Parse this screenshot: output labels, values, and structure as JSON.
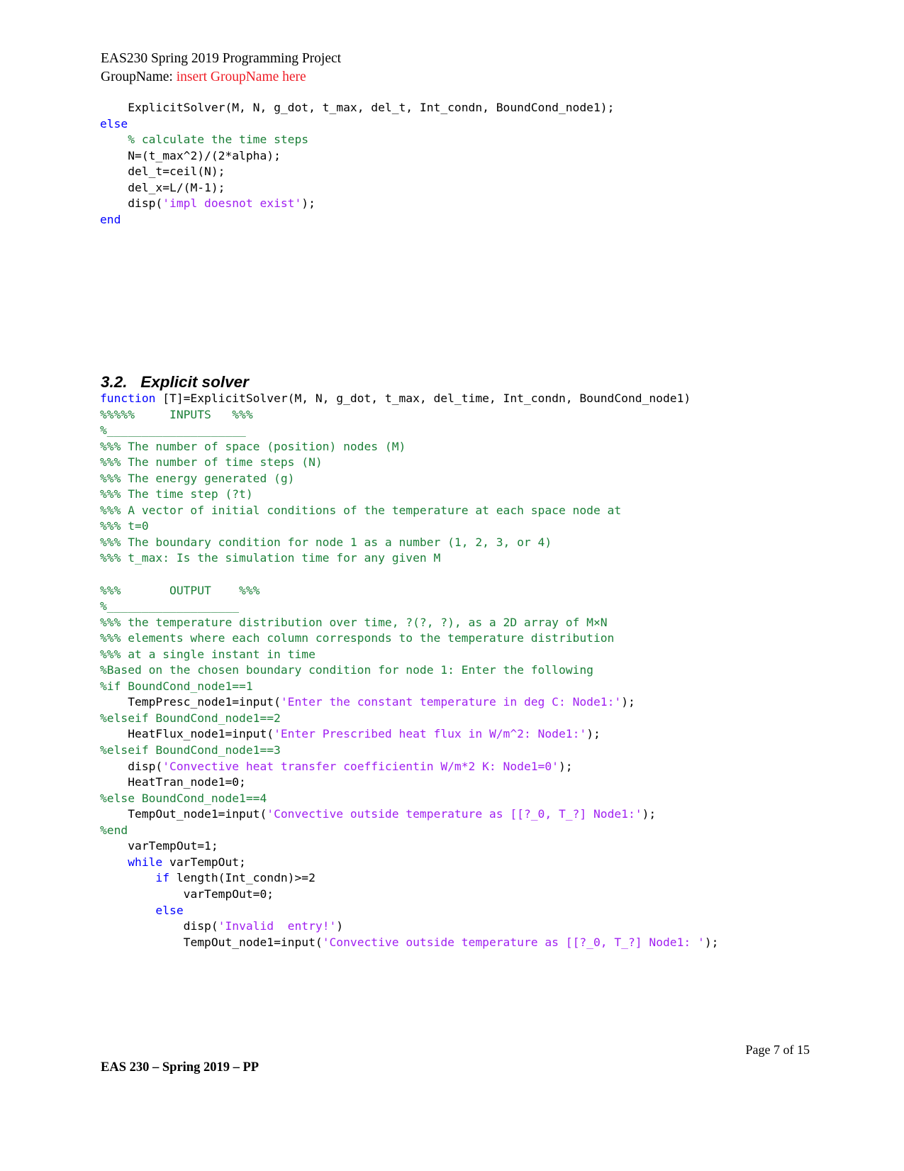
{
  "header": {
    "title_line": "EAS230 Spring 2019 Programming Project",
    "group_label": "GroupName: ",
    "group_value": "insert GroupName here"
  },
  "section": {
    "number": "3.2.",
    "title": "Explicit solver",
    "heading_full": "3.2.   Explicit solver"
  },
  "code_top": {
    "lines": [
      {
        "segments": [
          {
            "t": "    ExplicitSolver(M, N, g_dot, t_max, del_t, Int_condn, BoundCond_node1);",
            "c": "plain"
          }
        ]
      },
      {
        "segments": [
          {
            "t": "else",
            "c": "kw"
          }
        ]
      },
      {
        "segments": [
          {
            "t": "    ",
            "c": "plain"
          },
          {
            "t": "% calculate the time steps",
            "c": "cmt"
          }
        ]
      },
      {
        "segments": [
          {
            "t": "    N=(t_max^2)/(2*alpha);",
            "c": "plain"
          }
        ]
      },
      {
        "segments": [
          {
            "t": "    del_t=ceil(N);",
            "c": "plain"
          }
        ]
      },
      {
        "segments": [
          {
            "t": "    del_x=L/(M-1);",
            "c": "plain"
          }
        ]
      },
      {
        "segments": [
          {
            "t": "    disp(",
            "c": "plain"
          },
          {
            "t": "'impl doesnot exist'",
            "c": "str"
          },
          {
            "t": ");",
            "c": "plain"
          }
        ]
      },
      {
        "segments": [
          {
            "t": "end",
            "c": "kw"
          }
        ]
      }
    ]
  },
  "code_main": {
    "lines": [
      {
        "segments": [
          {
            "t": "function",
            "c": "kw"
          },
          {
            "t": " [T]=ExplicitSolver(M, N, g_dot, t_max, del_time, Int_condn, BoundCond_node1)",
            "c": "plain"
          }
        ]
      },
      {
        "segments": [
          {
            "t": "%%%%%     INPUTS   %%%",
            "c": "cmt"
          }
        ]
      },
      {
        "segments": [
          {
            "t": "%____________________",
            "c": "cmt"
          }
        ]
      },
      {
        "segments": [
          {
            "t": "%%% The number of space (position) nodes (M)",
            "c": "cmt"
          }
        ]
      },
      {
        "segments": [
          {
            "t": "%%% The number of time steps (N)",
            "c": "cmt"
          }
        ]
      },
      {
        "segments": [
          {
            "t": "%%% The energy generated (g)",
            "c": "cmt"
          }
        ]
      },
      {
        "segments": [
          {
            "t": "%%% The time step (?t)",
            "c": "cmt"
          }
        ]
      },
      {
        "segments": [
          {
            "t": "%%% A vector of initial conditions of the temperature at each space node at",
            "c": "cmt"
          }
        ]
      },
      {
        "segments": [
          {
            "t": "%%% t=0",
            "c": "cmt"
          }
        ]
      },
      {
        "segments": [
          {
            "t": "%%% The boundary condition for node 1 as a number (1, 2, 3, or 4)",
            "c": "cmt"
          }
        ]
      },
      {
        "segments": [
          {
            "t": "%%% t_max: Is the simulation time for any given M",
            "c": "cmt"
          }
        ]
      },
      {
        "segments": [
          {
            "t": "",
            "c": "plain"
          }
        ]
      },
      {
        "segments": [
          {
            "t": "%%%       OUTPUT    %%%",
            "c": "cmt"
          }
        ]
      },
      {
        "segments": [
          {
            "t": "%___________________",
            "c": "cmt"
          }
        ]
      },
      {
        "segments": [
          {
            "t": "%%% the temperature distribution over time, ?(?, ?), as a 2D array of M×N",
            "c": "cmt"
          }
        ]
      },
      {
        "segments": [
          {
            "t": "%%% elements where each column corresponds to the temperature distribution",
            "c": "cmt"
          }
        ]
      },
      {
        "segments": [
          {
            "t": "%%% at a single instant in time",
            "c": "cmt"
          }
        ]
      },
      {
        "segments": [
          {
            "t": "%Based on the chosen boundary condition for node 1: Enter the following",
            "c": "cmt"
          }
        ]
      },
      {
        "segments": [
          {
            "t": "%if BoundCond_node1==1",
            "c": "cmt"
          }
        ]
      },
      {
        "segments": [
          {
            "t": "    TempPresc_node1=input(",
            "c": "plain"
          },
          {
            "t": "'Enter the constant temperature in deg C: Node1:'",
            "c": "str"
          },
          {
            "t": ");",
            "c": "plain"
          }
        ]
      },
      {
        "segments": [
          {
            "t": "%elseif BoundCond_node1==2",
            "c": "cmt"
          }
        ]
      },
      {
        "segments": [
          {
            "t": "    HeatFlux_node1=input(",
            "c": "plain"
          },
          {
            "t": "'Enter Prescribed heat flux in W/m^2: Node1:'",
            "c": "str"
          },
          {
            "t": ");",
            "c": "plain"
          }
        ]
      },
      {
        "segments": [
          {
            "t": "%elseif BoundCond_node1==3",
            "c": "cmt"
          }
        ]
      },
      {
        "segments": [
          {
            "t": "    disp(",
            "c": "plain"
          },
          {
            "t": "'Convective heat transfer coefficientin W/m*2 K: Node1=0'",
            "c": "str"
          },
          {
            "t": ");",
            "c": "plain"
          }
        ]
      },
      {
        "segments": [
          {
            "t": "    HeatTran_node1=0;",
            "c": "plain"
          }
        ]
      },
      {
        "segments": [
          {
            "t": "%else BoundCond_node1==4",
            "c": "cmt"
          }
        ]
      },
      {
        "segments": [
          {
            "t": "    TempOut_node1=input(",
            "c": "plain"
          },
          {
            "t": "'Convective outside temperature as [[?_0, T_?] Node1:'",
            "c": "str"
          },
          {
            "t": ");",
            "c": "plain"
          }
        ]
      },
      {
        "segments": [
          {
            "t": "%end",
            "c": "cmt"
          }
        ]
      },
      {
        "segments": [
          {
            "t": "    varTempOut=1;",
            "c": "plain"
          }
        ]
      },
      {
        "segments": [
          {
            "t": "    ",
            "c": "plain"
          },
          {
            "t": "while",
            "c": "kw"
          },
          {
            "t": " varTempOut;",
            "c": "plain"
          }
        ]
      },
      {
        "segments": [
          {
            "t": "        ",
            "c": "plain"
          },
          {
            "t": "if",
            "c": "kw"
          },
          {
            "t": " length(Int_condn)>=2",
            "c": "plain"
          }
        ]
      },
      {
        "segments": [
          {
            "t": "            varTempOut=0;",
            "c": "plain"
          }
        ]
      },
      {
        "segments": [
          {
            "t": "        ",
            "c": "plain"
          },
          {
            "t": "else",
            "c": "kw"
          }
        ]
      },
      {
        "segments": [
          {
            "t": "            disp(",
            "c": "plain"
          },
          {
            "t": "'Invalid  entry!'",
            "c": "str"
          },
          {
            "t": ")",
            "c": "plain"
          }
        ]
      },
      {
        "segments": [
          {
            "t": "            TempOut_node1=input(",
            "c": "plain"
          },
          {
            "t": "'Convective outside temperature as [[?_0, T_?] Node1: '",
            "c": "str"
          },
          {
            "t": ");",
            "c": "plain"
          }
        ]
      }
    ]
  },
  "footer": {
    "page_label": "Page 7 of 15",
    "course_label": "EAS 230 – Spring 2019 – PP"
  },
  "colors": {
    "keyword": "#0000ff",
    "comment": "#1a7f37",
    "string": "#a020f0",
    "plain": "#000000",
    "accent_red": "#ee1c25"
  }
}
